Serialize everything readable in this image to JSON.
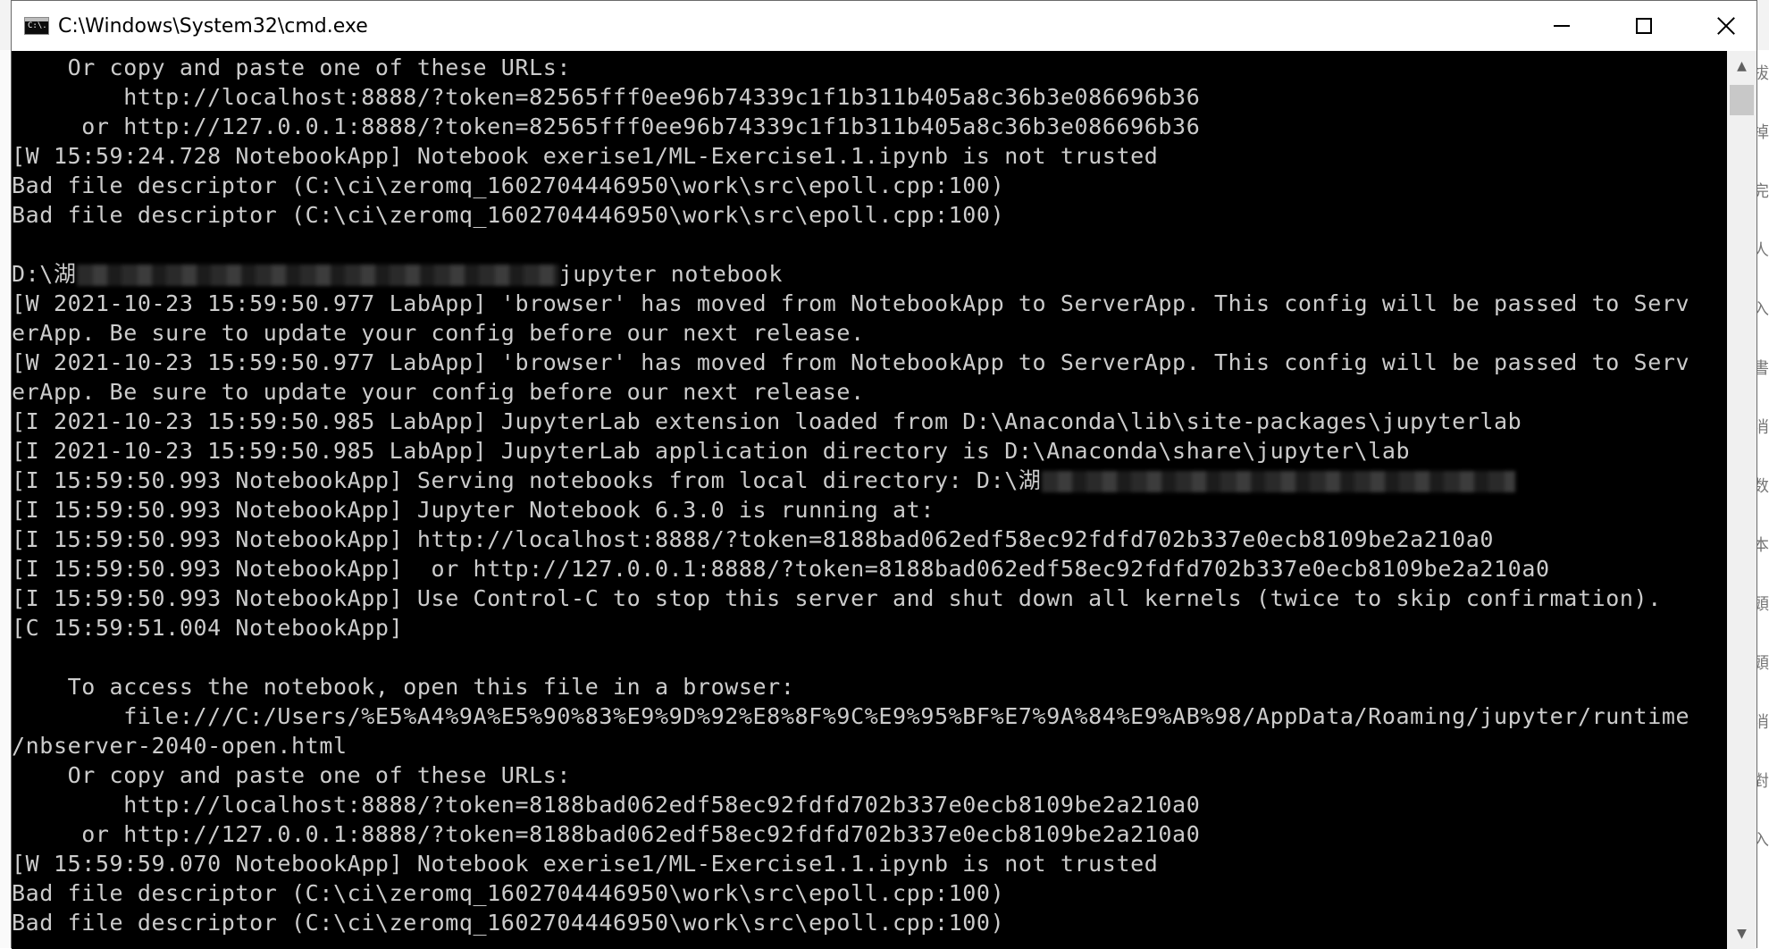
{
  "window": {
    "title": "C:\\Windows\\System32\\cmd.exe",
    "icon": "cmd-icon",
    "icon_text": "C:\\."
  },
  "controls": {
    "minimize": "minimize-icon",
    "maximize": "maximize-icon",
    "close": "close-icon"
  },
  "console": {
    "lines": [
      "    Or copy and paste one of these URLs:",
      "        http://localhost:8888/?token=82565fff0ee96b74339c1f1b311b405a8c36b3e086696b36",
      "     or http://127.0.0.1:8888/?token=82565fff0ee96b74339c1f1b311b405a8c36b3e086696b36",
      "[W 15:59:24.728 NotebookApp] Notebook exerise1/ML-Exercise1.1.ipynb is not trusted",
      "Bad file descriptor (C:\\ci\\zeromq_1602704446950\\work\\src\\epoll.cpp:100)",
      "Bad file descriptor (C:\\ci\\zeromq_1602704446950\\work\\src\\epoll.cpp:100)",
      "",
      "D:\\湖",
      "[W 2021-10-23 15:59:50.977 LabApp] 'browser' has moved from NotebookApp to ServerApp. This config will be passed to Serv",
      "erApp. Be sure to update your config before our next release.",
      "[W 2021-10-23 15:59:50.977 LabApp] 'browser' has moved from NotebookApp to ServerApp. This config will be passed to Serv",
      "erApp. Be sure to update your config before our next release.",
      "[I 2021-10-23 15:59:50.985 LabApp] JupyterLab extension loaded from D:\\Anaconda\\lib\\site-packages\\jupyterlab",
      "[I 2021-10-23 15:59:50.985 LabApp] JupyterLab application directory is D:\\Anaconda\\share\\jupyter\\lab",
      "[I 15:59:50.993 NotebookApp] Serving notebooks from local directory: D:\\湖",
      "[I 15:59:50.993 NotebookApp] Jupyter Notebook 6.3.0 is running at:",
      "[I 15:59:50.993 NotebookApp] http://localhost:8888/?token=8188bad062edf58ec92fdfd702b337e0ecb8109be2a210a0",
      "[I 15:59:50.993 NotebookApp]  or http://127.0.0.1:8888/?token=8188bad062edf58ec92fdfd702b337e0ecb8109be2a210a0",
      "[I 15:59:50.993 NotebookApp] Use Control-C to stop this server and shut down all kernels (twice to skip confirmation).",
      "[C 15:59:51.004 NotebookApp]",
      "",
      "    To access the notebook, open this file in a browser:",
      "        file:///C:/Users/%E5%A4%9A%E5%90%83%E9%9D%92%E8%8F%9C%E9%95%BF%E7%9A%84%E9%AB%98/AppData/Roaming/jupyter/runtime",
      "/nbserver-2040-open.html",
      "    Or copy and paste one of these URLs:",
      "        http://localhost:8888/?token=8188bad062edf58ec92fdfd702b337e0ecb8109be2a210a0",
      "     or http://127.0.0.1:8888/?token=8188bad062edf58ec92fdfd702b337e0ecb8109be2a210a0",
      "[W 15:59:59.070 NotebookApp] Notebook exerise1/ML-Exercise1.1.ipynb is not trusted",
      "Bad file descriptor (C:\\ci\\zeromq_1602704446950\\work\\src\\epoll.cpp:100)",
      "Bad file descriptor (C:\\ci\\zeromq_1602704446950\\work\\src\\epoll.cpp:100)"
    ],
    "command_suffix": "jupyter notebook"
  },
  "scrollbar": {
    "up": "▲",
    "down": "▼"
  },
  "background_fragments": [
    "拔",
    "掉",
    "完",
    "人",
    "入",
    "書",
    "消",
    "数",
    "本",
    "頭",
    "頭",
    "消",
    "對",
    "入"
  ]
}
